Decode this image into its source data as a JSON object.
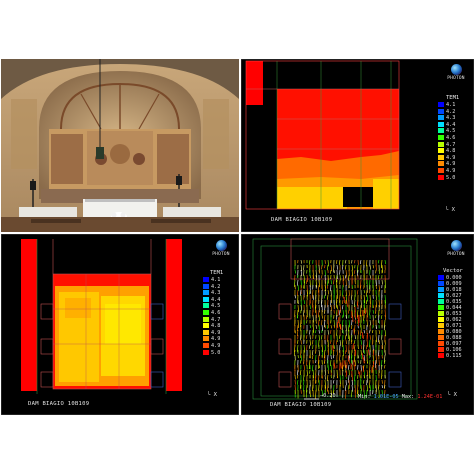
{
  "photo": {
    "alt_subject": "church apse with frescoes and altar"
  },
  "panels": {
    "top_right": {
      "logo_word": "PHOTON",
      "legend_title": "TEM1",
      "legend": [
        {
          "label": "4.1",
          "color": "#0000ff"
        },
        {
          "label": "4.2",
          "color": "#0047ff"
        },
        {
          "label": "4.3",
          "color": "#009bff"
        },
        {
          "label": "4.4",
          "color": "#00e0ff"
        },
        {
          "label": "4.5",
          "color": "#00ff9a"
        },
        {
          "label": "4.6",
          "color": "#33ff00"
        },
        {
          "label": "4.7",
          "color": "#b8ff00"
        },
        {
          "label": "4.8",
          "color": "#ffff00"
        },
        {
          "label": "4.9",
          "color": "#ffc800"
        },
        {
          "label": "4.9",
          "color": "#ff8a00"
        },
        {
          "label": "4.9",
          "color": "#ff4a00"
        },
        {
          "label": "5.0",
          "color": "#ff0000"
        }
      ],
      "caption": "DAM BIAGIO 10B109",
      "axis_label": "X"
    },
    "bottom_left": {
      "logo_word": "PHOTON",
      "legend_title": "TEM1",
      "legend": [
        {
          "label": "4.1",
          "color": "#0000ff"
        },
        {
          "label": "4.2",
          "color": "#0047ff"
        },
        {
          "label": "4.3",
          "color": "#009bff"
        },
        {
          "label": "4.4",
          "color": "#00e0ff"
        },
        {
          "label": "4.5",
          "color": "#00ff9a"
        },
        {
          "label": "4.6",
          "color": "#33ff00"
        },
        {
          "label": "4.7",
          "color": "#b8ff00"
        },
        {
          "label": "4.8",
          "color": "#ffff00"
        },
        {
          "label": "4.9",
          "color": "#ffc800"
        },
        {
          "label": "4.9",
          "color": "#ff8a00"
        },
        {
          "label": "4.9",
          "color": "#ff4a00"
        },
        {
          "label": "5.0",
          "color": "#ff0000"
        }
      ],
      "caption": "DAM BIAGIO 10B109",
      "axis_label": "X"
    },
    "bottom_right": {
      "logo_word": "PHOTON",
      "legend_title": "Vector",
      "legend": [
        {
          "label": "0.000",
          "color": "#0000ff"
        },
        {
          "label": "0.009",
          "color": "#0047ff"
        },
        {
          "label": "0.018",
          "color": "#009bff"
        },
        {
          "label": "0.027",
          "color": "#00e0ff"
        },
        {
          "label": "0.035",
          "color": "#00ff9a"
        },
        {
          "label": "0.044",
          "color": "#33ff00"
        },
        {
          "label": "0.053",
          "color": "#b8ff00"
        },
        {
          "label": "0.062",
          "color": "#ffff00"
        },
        {
          "label": "0.071",
          "color": "#ffc800"
        },
        {
          "label": "0.080",
          "color": "#ff8a00"
        },
        {
          "label": "0.088",
          "color": "#ff6a00"
        },
        {
          "label": "0.097",
          "color": "#ff4a00"
        },
        {
          "label": "0.106",
          "color": "#ff2a00"
        },
        {
          "label": "0.115",
          "color": "#ff0000"
        }
      ],
      "scale_label": "0.20",
      "min_label": "Min:",
      "min_value": "1.01E-05",
      "max_label": "Max:",
      "max_value": "1.24E-01",
      "min_color": "#4aa8ff",
      "max_color": "#ff3030",
      "caption": "DAM BIAGIO 10B109",
      "axis_label": "X"
    }
  }
}
